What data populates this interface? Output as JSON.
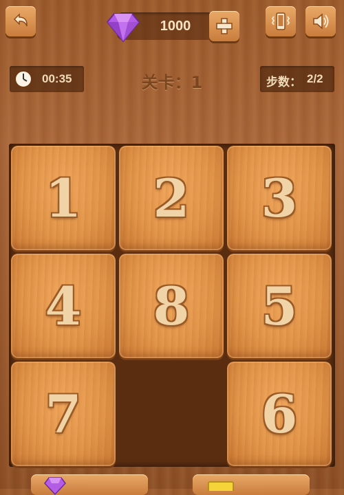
{
  "header": {
    "back_icon": "back-arrow-icon",
    "gem_icon": "gem-icon",
    "gem_count": "1000",
    "add_icon": "plus-icon",
    "vibrate_icon": "vibrate-icon",
    "sound_icon": "speaker-icon"
  },
  "stats": {
    "timer_icon": "clock-icon",
    "time": "00:35",
    "level_label": "关卡：",
    "level_value": "1",
    "steps_label": "步数：",
    "steps_value": "2/2"
  },
  "board": {
    "rows": 3,
    "cols": 3,
    "cells": [
      "1",
      "2",
      "3",
      "4",
      "8",
      "5",
      "7",
      "",
      "6"
    ]
  },
  "colors": {
    "tile": "#e09347",
    "board_bg": "#5a2d10",
    "gem": "#b45ce6"
  },
  "bottom_bar": {
    "left_button_icon": "gem-icon",
    "right_button_icon": "coupon-icon"
  }
}
